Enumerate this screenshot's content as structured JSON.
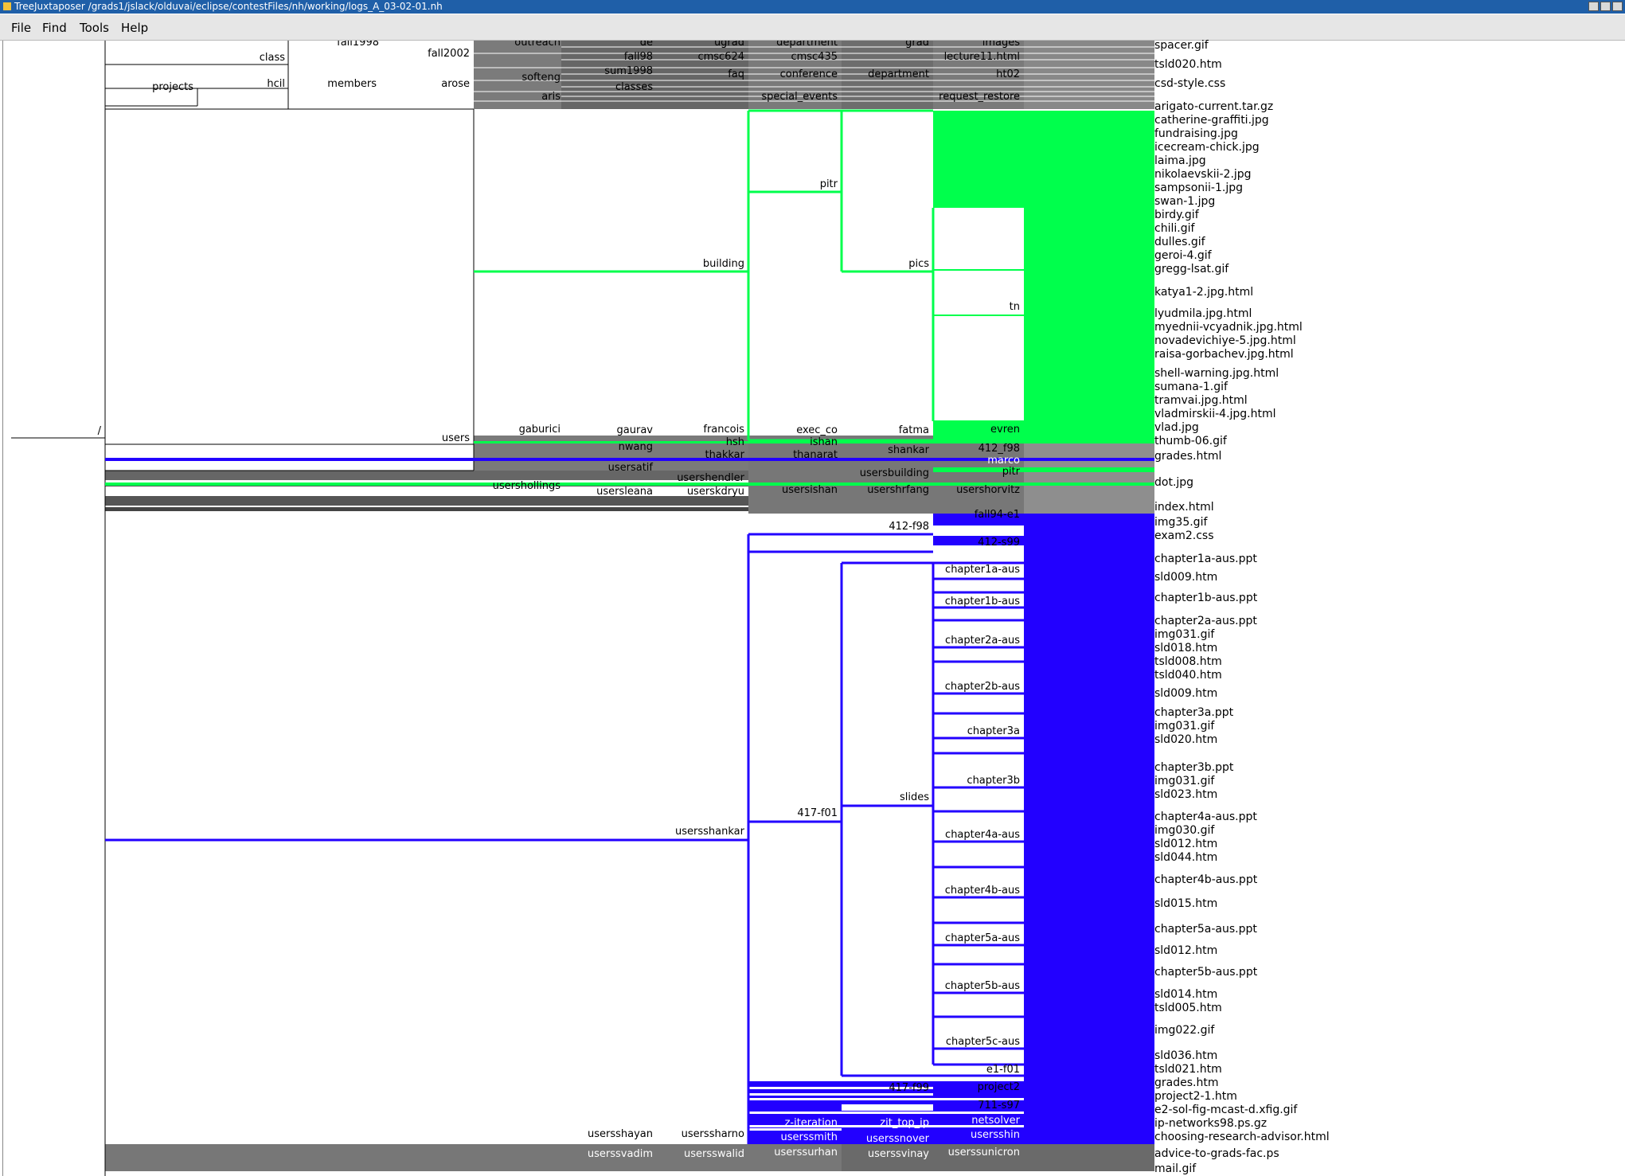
{
  "window": {
    "title": "TreeJuxtaposer /grads1/jslack/olduvai/eclipse/contestFiles/nh/working/logs_A_03-02-01.nh"
  },
  "menu": {
    "file": "File",
    "find": "Find",
    "tools": "Tools",
    "help": "Help"
  },
  "colors": {
    "green": "#00ff4c",
    "blue": "#2200ff",
    "titlebar": "#1f5fa8",
    "gray": "#6f6f6f"
  },
  "tree": {
    "root": "/",
    "top": {
      "fall1998": "fall1998",
      "class": "class",
      "fall2002": "fall2002",
      "outreach": "outreach",
      "de": "de",
      "ugrad": "ugrad",
      "department": "department",
      "grad": "grad",
      "images": "images",
      "fall98": "fall98",
      "cmsc624": "cmsc624",
      "cmsc435": "cmsc435",
      "lecture11html": "lecture11.html",
      "sum1998": "sum1998",
      "faq": "faq",
      "conference": "conference",
      "department2": "department",
      "ht02": "ht02",
      "projects": "projects",
      "hcil": "hcil",
      "members": "members",
      "arose": "arose",
      "softeng": "softeng",
      "classes": "classes",
      "aris": "aris",
      "special_events": "special_events",
      "request_restore": "request_restore"
    },
    "green": {
      "users": "users",
      "building": "building",
      "pitr": "pitr",
      "pics": "pics",
      "tn": "tn",
      "gaburici": "gaburici",
      "gaurav": "gaurav",
      "francois": "francois",
      "exec_co": "exec_co",
      "fatma": "fatma",
      "evren": "evren"
    },
    "mid": {
      "nwang": "nwang",
      "hsh": "hsh",
      "ishan": "ishan",
      "thakkar": "thakkar",
      "thanarat": "thanarat",
      "shankar": "shankar",
      "f412_f98": "412_f98",
      "marco": "marco",
      "usersatif": "usersatif",
      "usersbuilding": "usersbuilding",
      "pitr": "pitr",
      "usershendler": "usershendler",
      "usershollings": "usershollings",
      "usersleana": "usersleana",
      "userskdryu": "userskdryu",
      "usersishan": "usersishan",
      "usershrfang": "usershrfang",
      "usershorvitz": "usershorvitz"
    },
    "blue": {
      "usersshankar": "usersshankar",
      "f417_f01": "417-f01",
      "slides": "slides",
      "fall94_e1": "fall94-e1",
      "f412_f98": "412-f98",
      "f412_s99": "412-s99",
      "ch1a": "chapter1a-aus",
      "ch1b": "chapter1b-aus",
      "ch2a": "chapter2a-aus",
      "ch2b": "chapter2b-aus",
      "ch3a": "chapter3a",
      "ch3b": "chapter3b",
      "ch4a": "chapter4a-aus",
      "ch4b": "chapter4b-aus",
      "ch5a": "chapter5a-aus",
      "ch5b": "chapter5b-aus",
      "ch5c": "chapter5c-aus",
      "e1_f01": "e1-f01",
      "f417_f99": "417-f99",
      "project2": "project2",
      "f711_s97": "711-s97",
      "z_iteration": "z-iteration",
      "zit_top_ip": "zit_top_ip",
      "netsolver": "netsolver",
      "usersshin": "usersshin",
      "userssmith": "userssmith",
      "userssnover": "userssnover",
      "usersshayan": "usersshayan",
      "userssharno": "userssharno"
    },
    "bottom": {
      "userssvadim": "userssvadim",
      "usersswalid": "usersswalid",
      "userssurhan": "userssurhan",
      "userssvinay": "userssvinay",
      "userssunicron": "userssunicron"
    }
  },
  "leaves": [
    "spacer.gif",
    "tsld020.htm",
    "csd-style.css",
    "arigato-current.tar.gz",
    "catherine-graffiti.jpg",
    "fundraising.jpg",
    "icecream-chick.jpg",
    "laima.jpg",
    "nikolaevskii-2.jpg",
    "sampsonii-1.jpg",
    "swan-1.jpg",
    "birdy.gif",
    "chili.gif",
    "dulles.gif",
    "geroi-4.gif",
    "gregg-lsat.gif",
    "katya1-2.jpg.html",
    "lyudmila.jpg.html",
    "myednii-vcyadnik.jpg.html",
    "novadevichiye-5.jpg.html",
    "raisa-gorbachev.jpg.html",
    "shell-warning.jpg.html",
    "sumana-1.gif",
    "tramvai.jpg.html",
    "vladmirskii-4.jpg.html",
    "vlad.jpg",
    "thumb-06.gif",
    "grades.html",
    "dot.jpg",
    "index.html",
    "img35.gif",
    "exam2.css",
    "chapter1a-aus.ppt",
    "sld009.htm",
    "chapter1b-aus.ppt",
    "chapter2a-aus.ppt",
    "img031.gif",
    "sld018.htm",
    "tsld008.htm",
    "tsld040.htm",
    "sld009.htm",
    "chapter3a.ppt",
    "img031.gif",
    "sld020.htm",
    "chapter3b.ppt",
    "img031.gif",
    "sld023.htm",
    "chapter4a-aus.ppt",
    "img030.gif",
    "sld012.htm",
    "sld044.htm",
    "chapter4b-aus.ppt",
    "sld015.htm",
    "chapter5a-aus.ppt",
    "sld012.htm",
    "chapter5b-aus.ppt",
    "sld014.htm",
    "tsld005.htm",
    "img022.gif",
    "sld036.htm",
    "tsld021.htm",
    "grades.htm",
    "project2-1.htm",
    "e2-sol-fig-mcast-d.xfig.gif",
    "ip-networks98.ps.gz",
    "choosing-research-advisor.html",
    "advice-to-grads-fac.ps",
    "mail.gif"
  ]
}
